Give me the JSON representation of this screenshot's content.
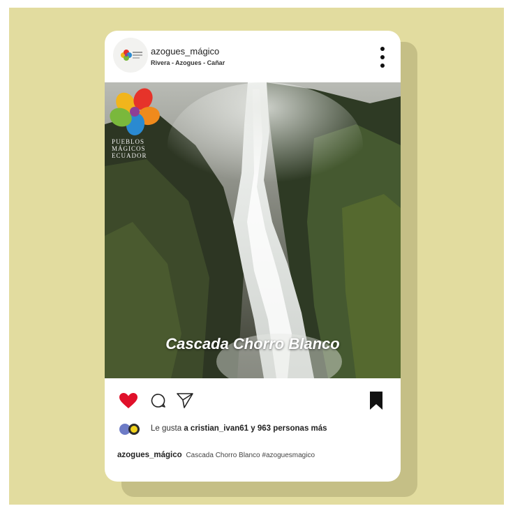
{
  "post": {
    "username": "azogues_mágico",
    "location": "Rivera - Azogues - Cañar",
    "photo_title": "Cascada Chorro Blanco",
    "logo_text_lines": [
      "PUEBLOS",
      "MÁGICOS",
      "ECUADOR"
    ],
    "liked_by_prefix": "Le gusta",
    "liked_by_user": "a cristian_ivan61",
    "liked_by_others": "y 963 personas más",
    "caption_user": "azogues_mágico",
    "caption_text": "Cascada Chorro Blanco #azoguesmagico"
  },
  "icons": {
    "more": "more-vertical-icon",
    "like": "heart-icon",
    "comment": "comment-icon",
    "share": "send-icon",
    "save": "bookmark-icon"
  },
  "colors": {
    "background": "#e2dc9f",
    "card": "#ffffff",
    "like_active": "#e0102a",
    "text": "#222222"
  }
}
